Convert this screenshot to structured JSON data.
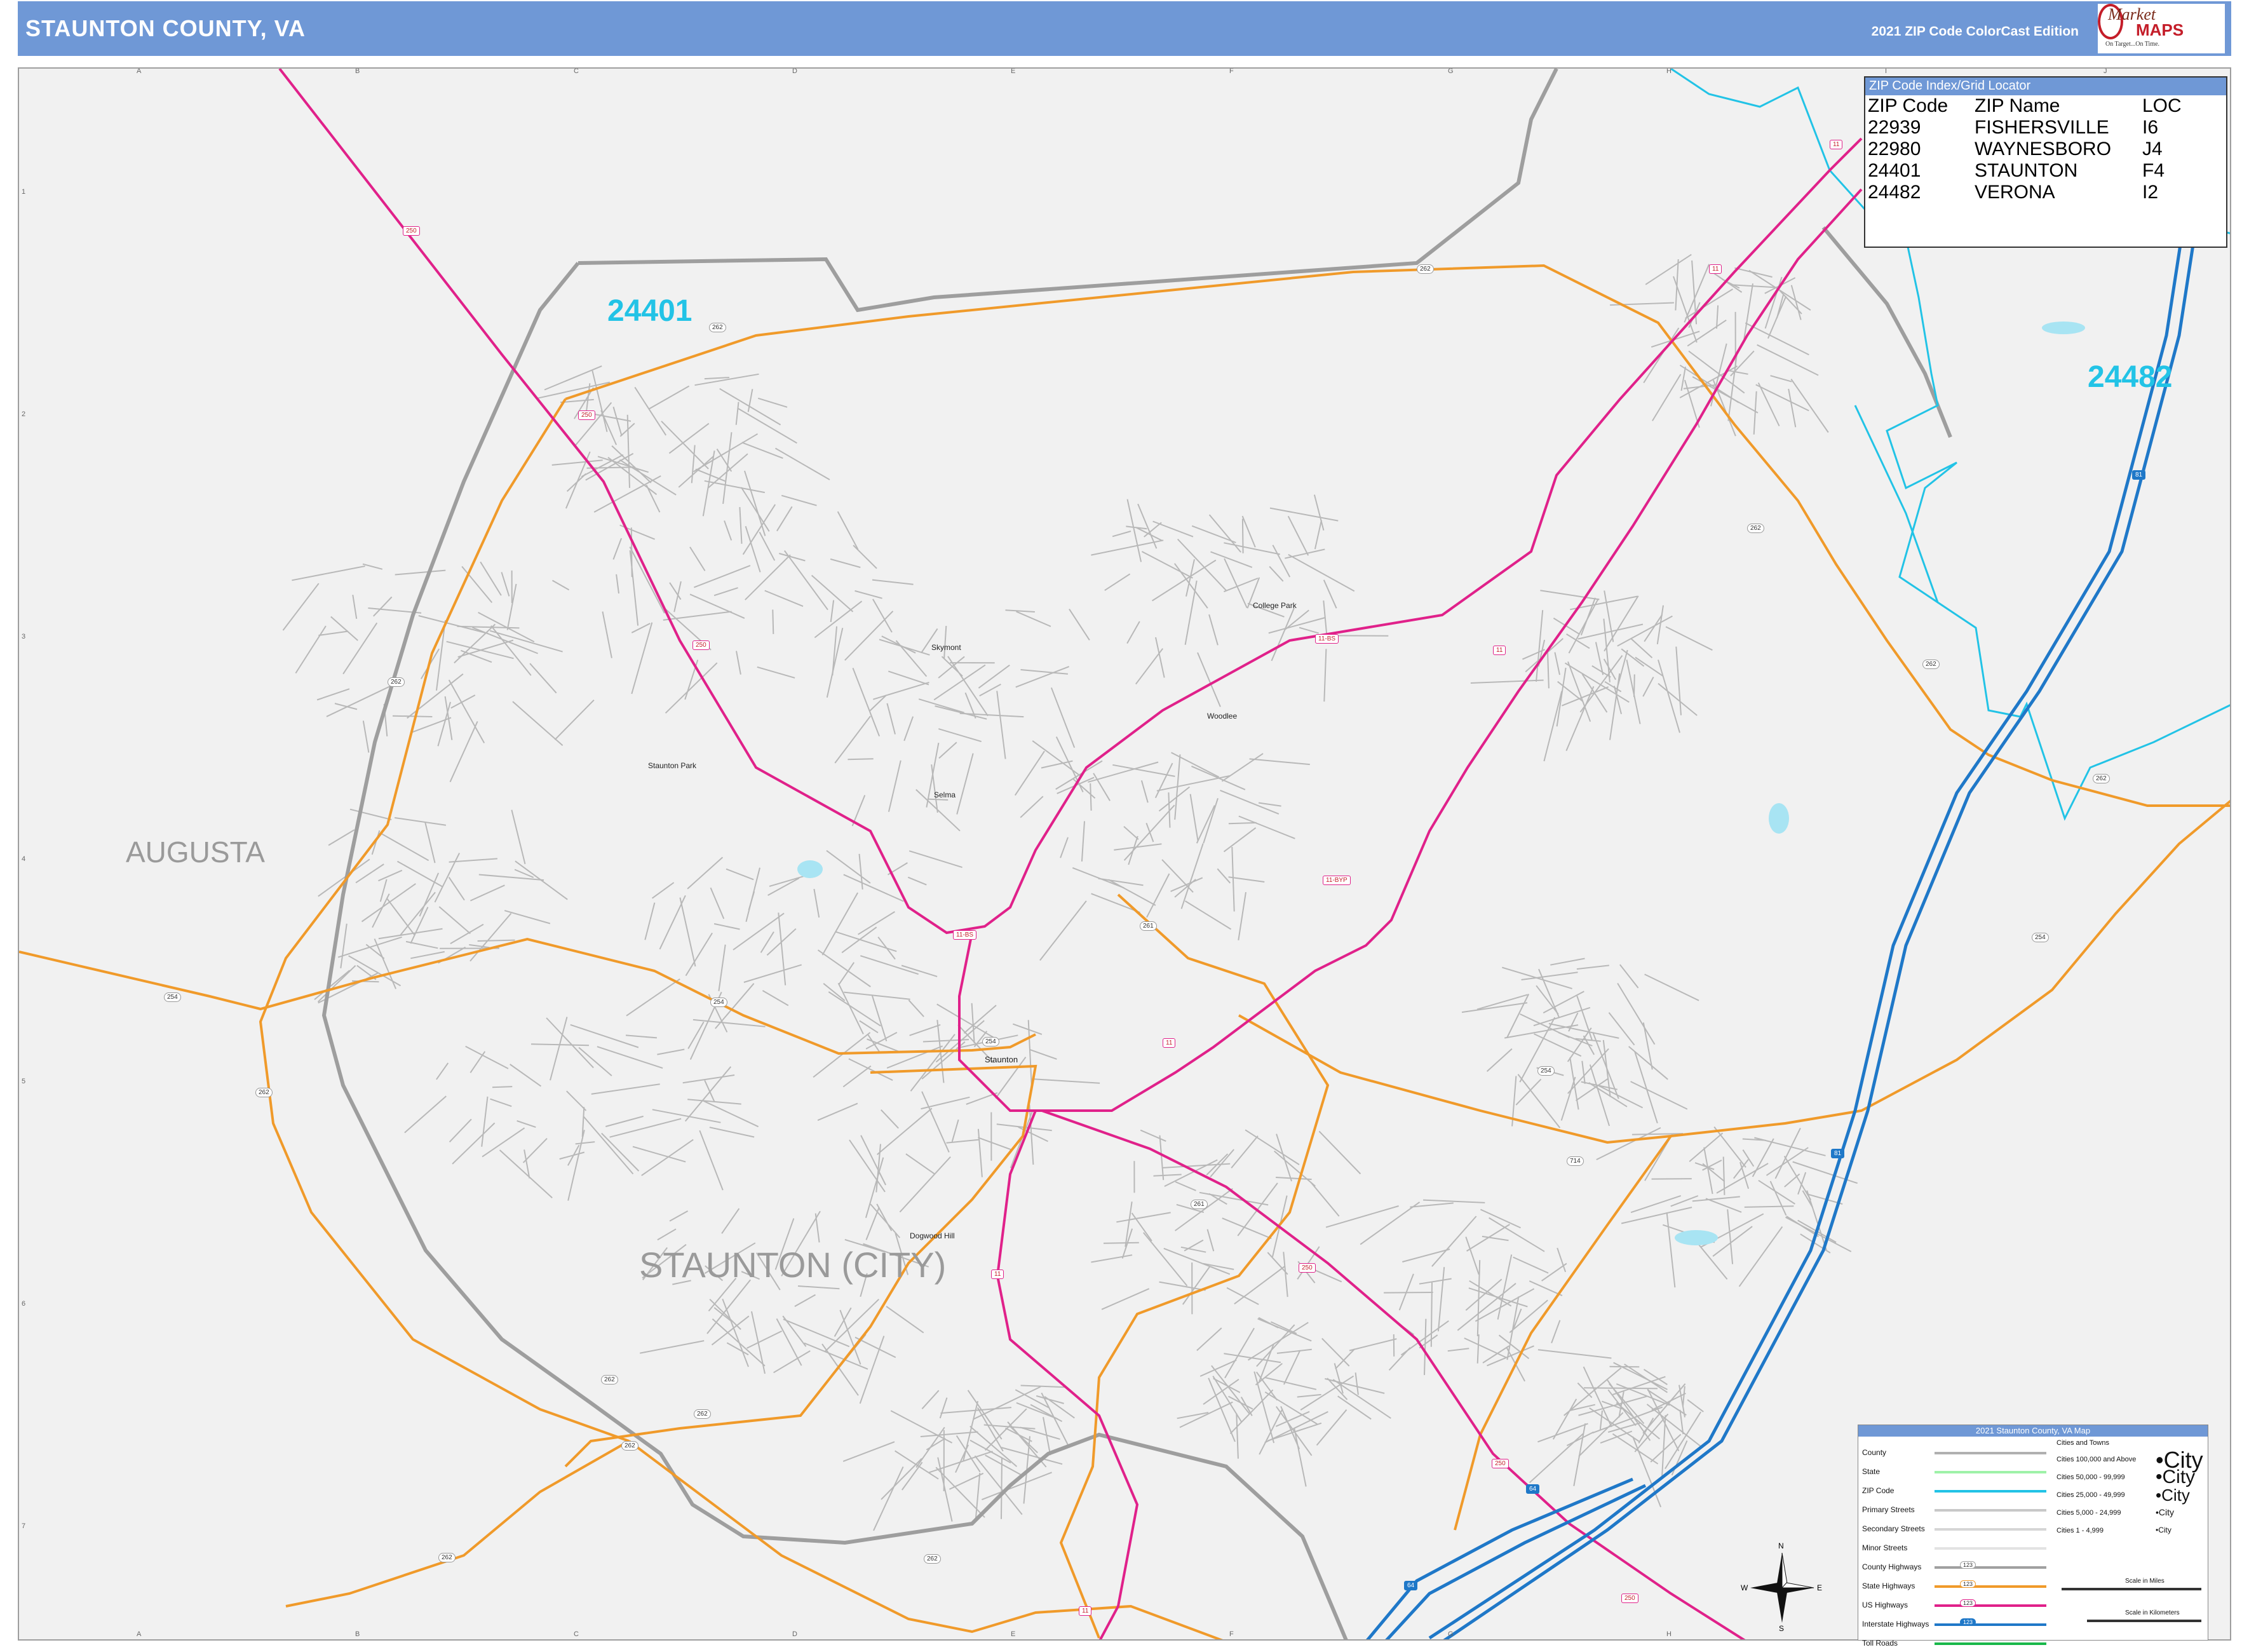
{
  "header": {
    "title": "STAUNTON COUNTY, VA",
    "edition": "2021 ZIP Code ColorCast Edition",
    "logo": {
      "brand_a": "Market",
      "brand_b": "MAPS",
      "tagline": "On Target...On Time."
    }
  },
  "grid": {
    "letters": [
      "A",
      "B",
      "C",
      "D",
      "E",
      "F",
      "G",
      "H",
      "I",
      "J"
    ],
    "numbers": [
      "1",
      "2",
      "3",
      "4",
      "5",
      "6",
      "7"
    ]
  },
  "zip_index": {
    "title": "ZIP Code Index/Grid Locator",
    "headers": [
      "ZIP Code",
      "ZIP Name",
      "LOC"
    ],
    "rows": [
      [
        "22939",
        "FISHERSVILLE",
        "I6"
      ],
      [
        "22980",
        "WAYNESBORO",
        "J4"
      ],
      [
        "24401",
        "STAUNTON",
        "F4"
      ],
      [
        "24482",
        "VERONA",
        "I2"
      ]
    ]
  },
  "region_labels": {
    "augusta": "AUGUSTA",
    "staunton_city": "STAUNTON (CITY)"
  },
  "zip_labels": {
    "z24401": "24401",
    "z24482": "24482"
  },
  "places": {
    "skymont": "Skymont",
    "college_park": "College Park",
    "woodlee": "Woodlee",
    "staunton_park": "Staunton Park",
    "selma": "Selma",
    "staunton": "Staunton",
    "dogwood_hill": "Dogwood Hill"
  },
  "route_shields": {
    "r250": "250",
    "r262": "262",
    "r11": "11",
    "r11bp": "11-BYP",
    "r11bs": "11-BS",
    "r254": "254",
    "r261": "261",
    "r714": "714",
    "r64": "64",
    "r81": "81"
  },
  "legend": {
    "title": "2021 Staunton County, VA Map",
    "items": [
      "County",
      "State",
      "ZIP Code",
      "Primary Streets",
      "Secondary Streets",
      "Minor Streets",
      "County Highways",
      "State Highways",
      "US Highways",
      "Interstate Highways",
      "Toll Roads"
    ],
    "cities_title": "Cities and Towns",
    "cities": [
      "Cities 100,000 and Above",
      "Cities 50,000 - 99,999",
      "Cities 25,000 - 49,999",
      "Cities 5,000 - 24,999",
      "Cities 1 - 4,999"
    ],
    "city_sample": "City",
    "shield_sample": "123",
    "scale_miles": "Scale in Miles",
    "scale_km": "Scale in Kilometers",
    "scale_ticks": [
      "0",
      ".25",
      ".5"
    ]
  },
  "compass": {
    "n": "N",
    "s": "S",
    "e": "E",
    "w": "W"
  },
  "colors": {
    "header_bg": "#6f98d6",
    "county_line": "#9e9e9e",
    "zip_line": "#22c3e6",
    "state_hwy": "#f09a2a",
    "us_hwy": "#e0218a",
    "interstate": "#1f78c8",
    "street": "#b8b8b8",
    "map_bg": "#f1f1f1"
  }
}
